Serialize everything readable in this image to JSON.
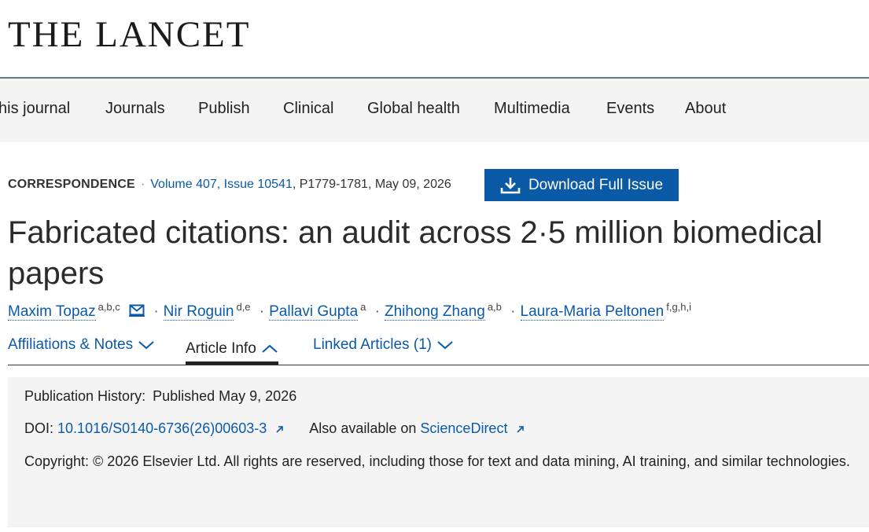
{
  "brand": {
    "logo_text": "THE LANCET"
  },
  "nav": {
    "items": [
      {
        "label": "his journal"
      },
      {
        "label": "Journals"
      },
      {
        "label": "Publish"
      },
      {
        "label": "Clinical"
      },
      {
        "label": "Global health"
      },
      {
        "label": "Multimedia"
      },
      {
        "label": "Events"
      },
      {
        "label": "About"
      }
    ]
  },
  "article": {
    "type": "CORRESPONDENCE",
    "volume_issue": "Volume 407, Issue 10541",
    "pages_date": ", P1779-1781, May 09, 2026",
    "download_label": "Download Full Issue",
    "title": "Fabricated citations: an audit across 2·5 million biomedical papers",
    "authors": [
      {
        "name": "Maxim Topaz",
        "aff": "a,b,c"
      },
      {
        "name": "Nir Roguin",
        "aff": "d,e"
      },
      {
        "name": "Pallavi Gupta",
        "aff": "a"
      },
      {
        "name": "Zhihong Zhang",
        "aff": "a,b"
      },
      {
        "name": "Laura-Maria Peltonen",
        "aff": "f,g,h,i"
      }
    ]
  },
  "tabs": {
    "affiliations": "Affiliations & Notes",
    "article_info": "Article Info",
    "linked": "Linked Articles (1)"
  },
  "info": {
    "history_label": "Publication History:",
    "history_value": "Published May 9, 2026",
    "doi_label": "DOI:",
    "doi_value": "10.1016/S0140-6736(26)00603-3",
    "also_label": "Also available on",
    "also_link": "ScienceDirect",
    "copyright": "Copyright: © 2026 Elsevier Ltd. All rights are reserved, including those for text and data mining, AI training, and similar technologies."
  },
  "colors": {
    "link": "#0b5aa8",
    "button_bg": "#0b5aa8",
    "nav_bg": "#f4f4f4",
    "nav_rule": "#5c7a89"
  },
  "icons": {
    "download": "download-icon",
    "mail": "mail-icon",
    "chevron_down": "chevron-down-icon",
    "chevron_up": "chevron-up-icon",
    "external": "external-link-icon"
  }
}
